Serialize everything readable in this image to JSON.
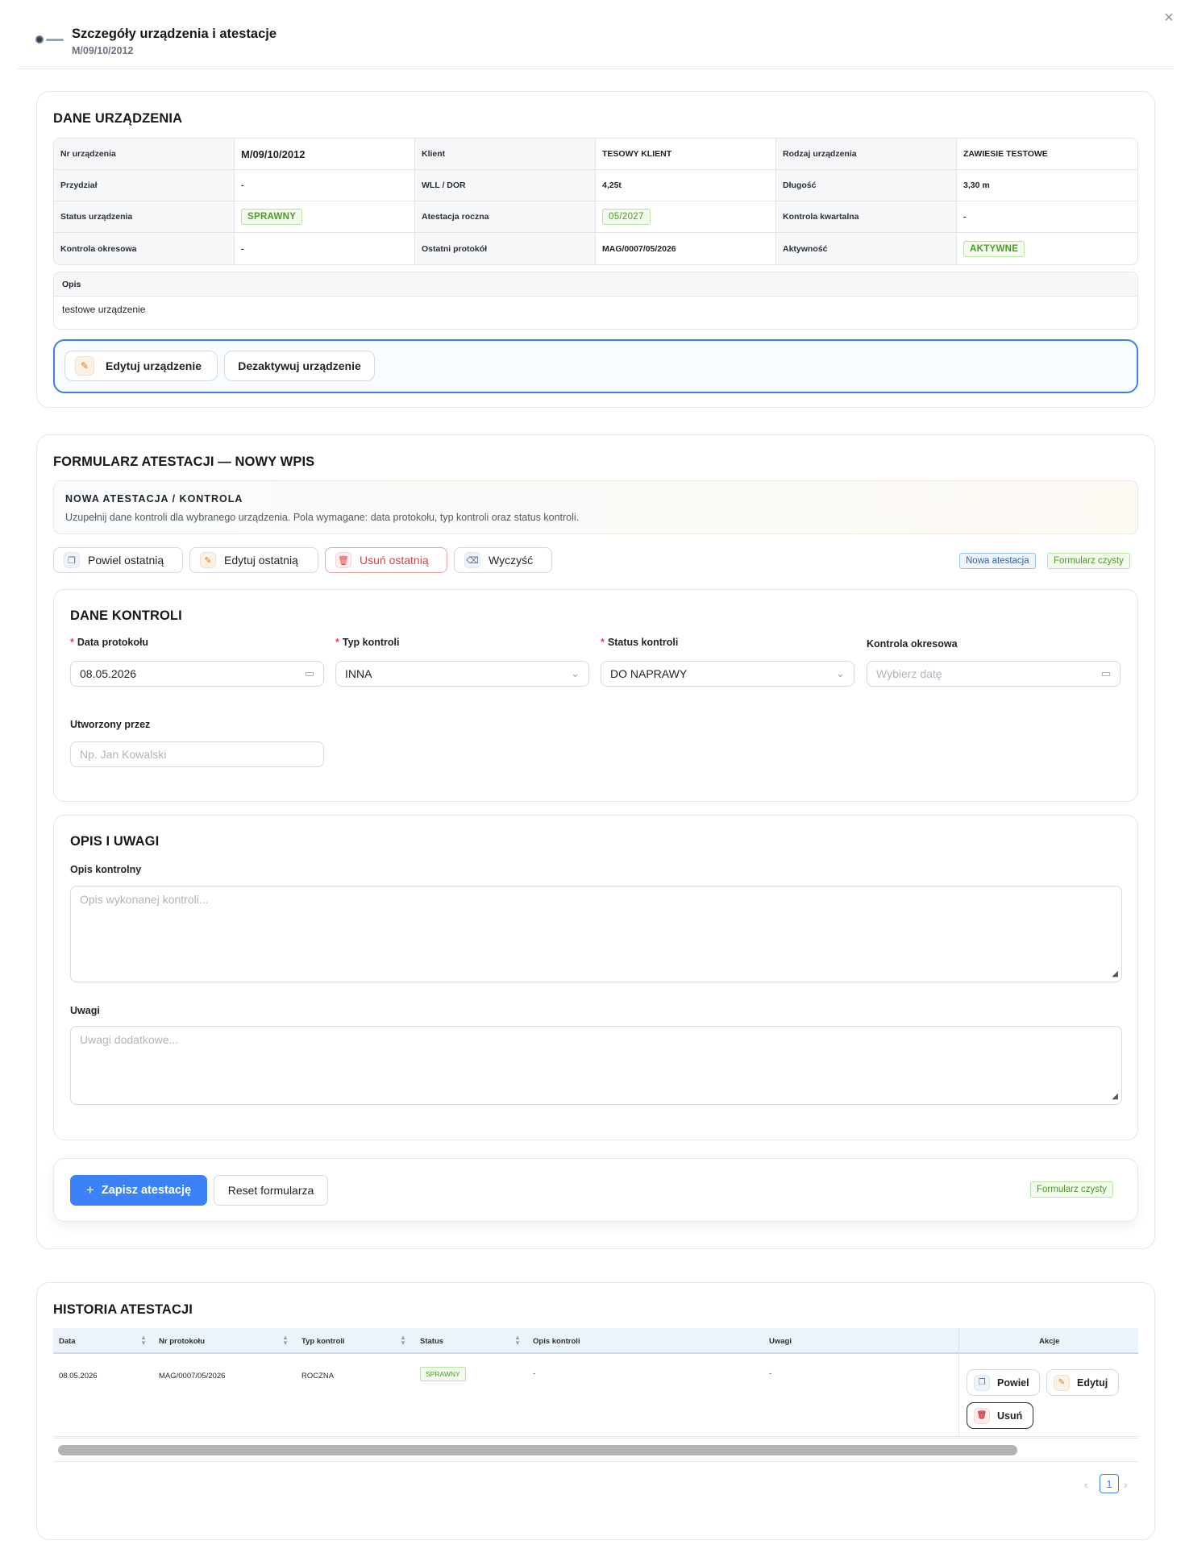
{
  "header": {
    "title": "Szczegóły urządzenia i atestacje",
    "subtitle": "M/09/10/2012",
    "close_icon": "×"
  },
  "device": {
    "section_title": "DANE URZĄDZENIA",
    "rows": [
      [
        {
          "label": "Nr urządzenia",
          "value": "M/09/10/2012"
        },
        {
          "label": "Klient",
          "value": "TESOWY KLIENT"
        },
        {
          "label": "Rodzaj urządzenia",
          "value": "ZAWIESIE TESTOWE"
        }
      ],
      [
        {
          "label": "Przydział",
          "value": "-"
        },
        {
          "label": "WLL / DOR",
          "value": "4,25t"
        },
        {
          "label": "Długość",
          "value": "3,30 m"
        }
      ],
      [
        {
          "label": "Status urządzenia",
          "value": "SPRAWNY"
        },
        {
          "label": "Atestacja roczna",
          "value": "05/2027"
        },
        {
          "label": "Kontrola kwartalna",
          "value": "-"
        }
      ],
      [
        {
          "label": "Kontrola okresowa",
          "value": "-"
        },
        {
          "label": "Ostatni protokół",
          "value": "MAG/0007/05/2026"
        },
        {
          "label": "Aktywność",
          "value": "AKTYWNE"
        }
      ]
    ],
    "opis_label": "Opis",
    "opis_value": "testowe urządzenie",
    "edit_button": "Edytuj urządzenie",
    "deactivate_button": "Dezaktywuj urządzenie"
  },
  "form": {
    "section_title": "FORMULARZ ATESTACJI — NOWY WPIS",
    "info_title": "NOWA ATESTACJA / KONTROLA",
    "info_text": "Uzupełnij dane kontroli dla wybranego urządzenia. Pola wymagane: data protokołu, typ kontroli oraz status kontroli.",
    "toolbar": {
      "copy_last": "Powiel ostatnią",
      "edit_last": "Edytuj ostatnią",
      "delete_last": "Usuń ostatnią",
      "clear": "Wyczyść"
    },
    "badges": {
      "new": "Nowa atestacja",
      "clean": "Formularz czysty"
    },
    "kontrola": {
      "title": "DANE KONTROLI",
      "date_label": "Data protokołu",
      "date_value": "08.05.2026",
      "type_label": "Typ kontroli",
      "type_value": "INNA",
      "status_label": "Status kontroli",
      "status_value": "DO NAPRAWY",
      "periodic_label": "Kontrola okresowa",
      "periodic_placeholder": "Wybierz datę",
      "created_label": "Utworzony przez",
      "created_placeholder": "Np. Jan Kowalski"
    },
    "notes": {
      "title": "OPIS I UWAGI",
      "desc_label": "Opis kontrolny",
      "desc_placeholder": "Opis wykonanej kontroli...",
      "remarks_label": "Uwagi",
      "remarks_placeholder": "Uwagi dodatkowe..."
    },
    "save_button": "Zapisz atestację",
    "reset_button": "Reset formularza",
    "state_badge": "Formularz czysty"
  },
  "history": {
    "section_title": "HISTORIA ATESTACJI",
    "columns": {
      "date": "Data",
      "protocol": "Nr protokołu",
      "type": "Typ kontroli",
      "status": "Status",
      "desc": "Opis kontroli",
      "remarks": "Uwagi",
      "actions": "Akcje"
    },
    "rows": [
      {
        "date": "08.05.2026",
        "protocol": "MAG/0007/05/2026",
        "type": "ROCZNA",
        "status": "SPRAWNY",
        "desc": "-",
        "remarks": "-"
      }
    ],
    "row_actions": {
      "copy": "Powiel",
      "edit": "Edytuj",
      "delete": "Usuń"
    },
    "pagination": {
      "current": "1",
      "prev": "‹",
      "next": "›"
    }
  }
}
